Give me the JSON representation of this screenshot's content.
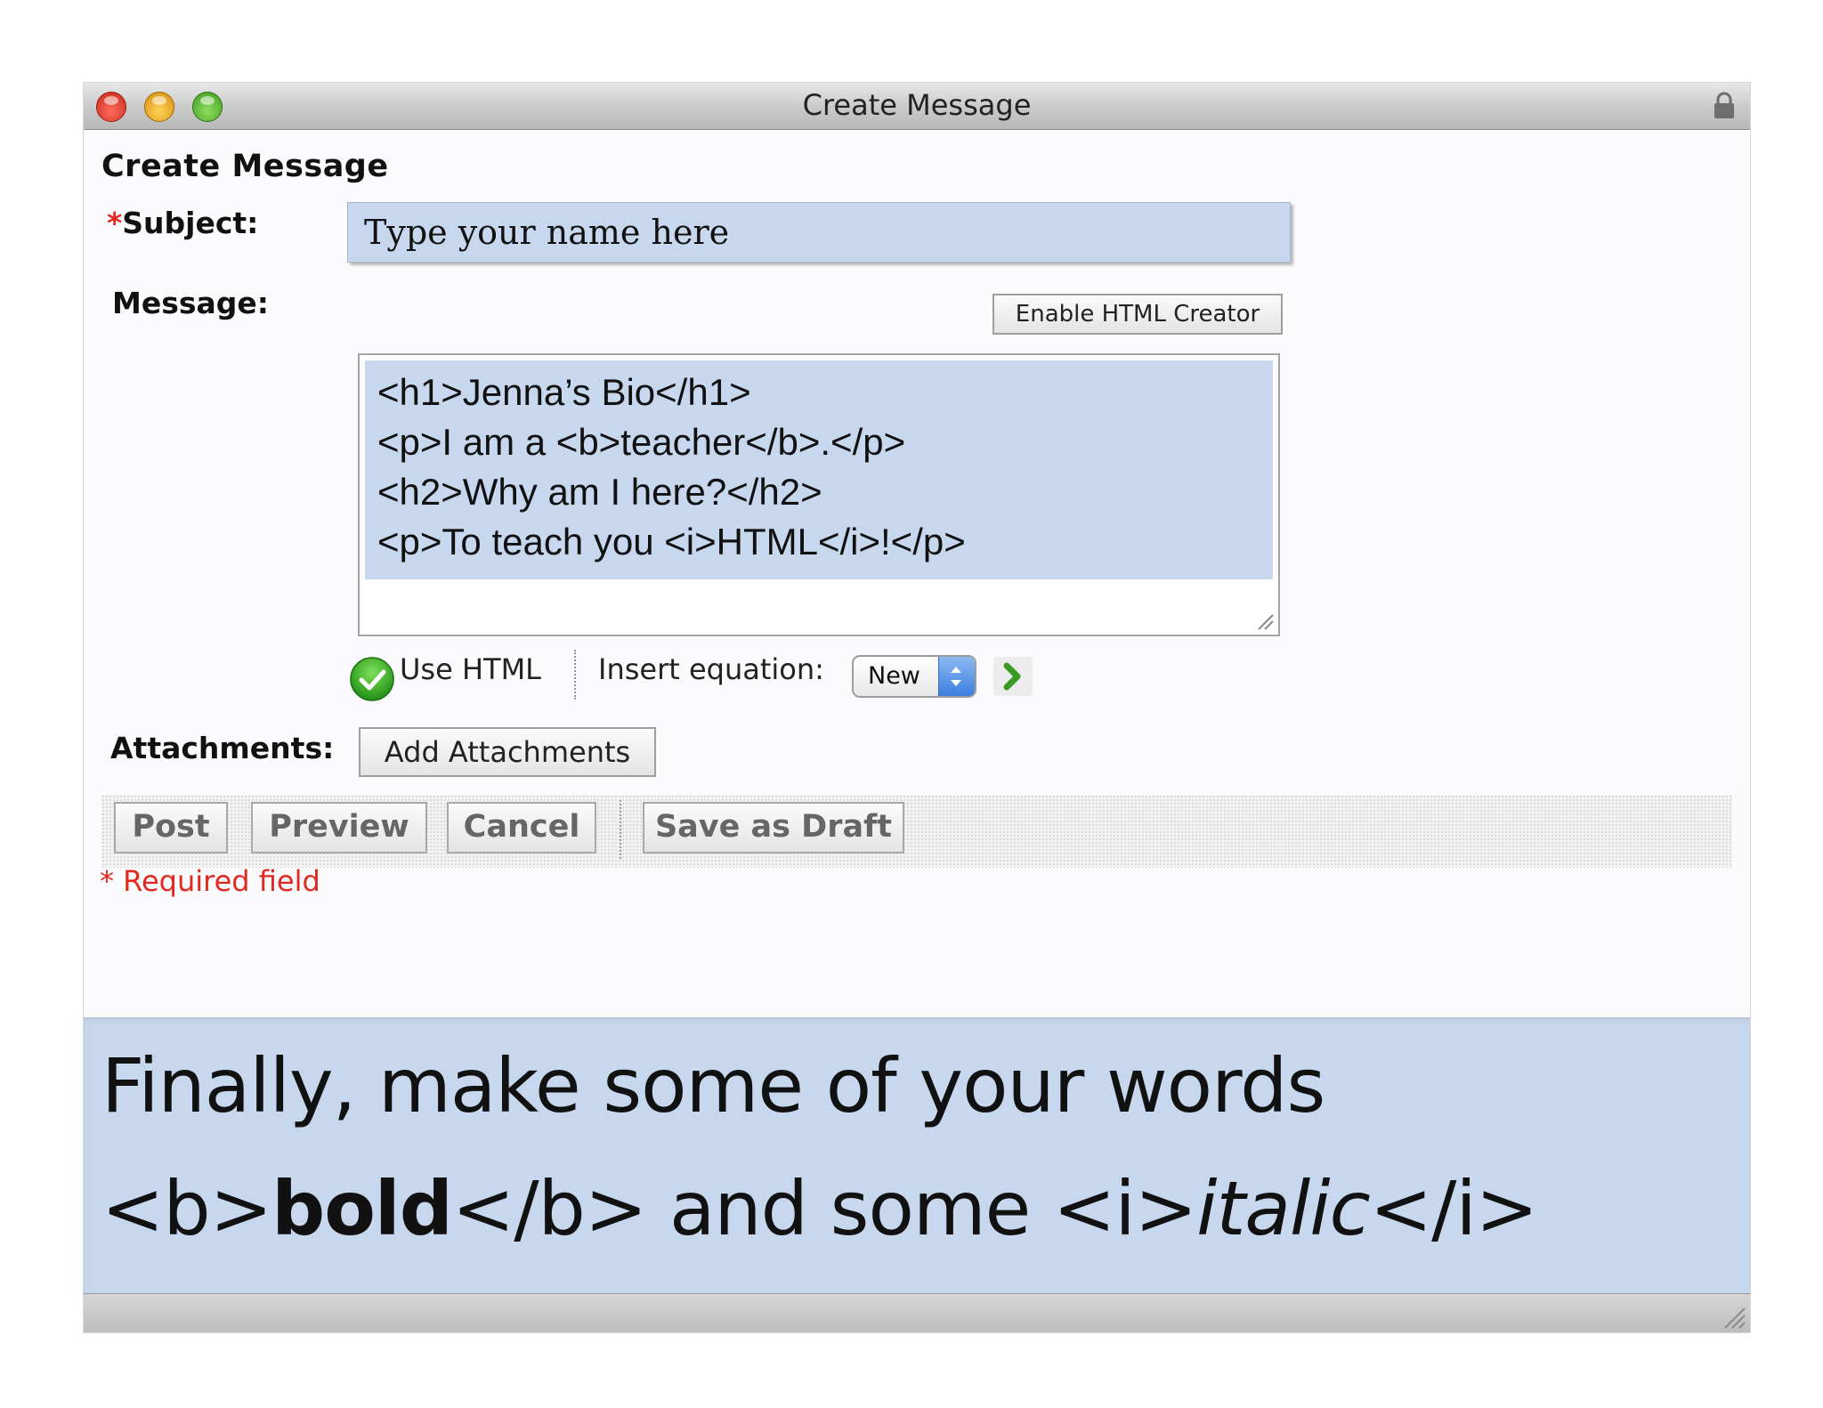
{
  "window": {
    "title": "Create Message",
    "controls": {
      "close": "close-button",
      "minimize": "minimize-button",
      "zoom": "zoom-button"
    },
    "lock_icon": "lock-icon"
  },
  "form": {
    "heading": "Create Message",
    "subject": {
      "required_mark": "*",
      "label": "Subject:",
      "value": "Type your name here"
    },
    "message": {
      "label": "Message:",
      "enable_html_button": "Enable HTML Creator",
      "lines": [
        "<h1>Jenna’s Bio</h1>",
        "<p>I am a <b>teacher</b>.</p>",
        "<h2>Why am I here?</h2>",
        "<p>To teach you <i>HTML</i>!</p>"
      ]
    },
    "options": {
      "use_html_label": "Use HTML",
      "insert_equation_label": "Insert equation:",
      "equation_select_value": "New",
      "colors": {
        "check_green": "#2fa51e",
        "select_blue": "#3c7fe0"
      }
    },
    "attachments": {
      "label": "Attachments:",
      "button": "Add Attachments"
    },
    "actions": {
      "post": "Post",
      "preview": "Preview",
      "cancel": "Cancel",
      "save_draft": "Save as Draft"
    },
    "required_note": "* Required field"
  },
  "caption": {
    "line1": "Finally, make some of your words",
    "line2_parts": [
      "<b>",
      "bold",
      "</b> and some <i>",
      "italic",
      "</i>"
    ]
  },
  "colors": {
    "highlight": "#c7d7ed",
    "required": "#e02a1f"
  }
}
